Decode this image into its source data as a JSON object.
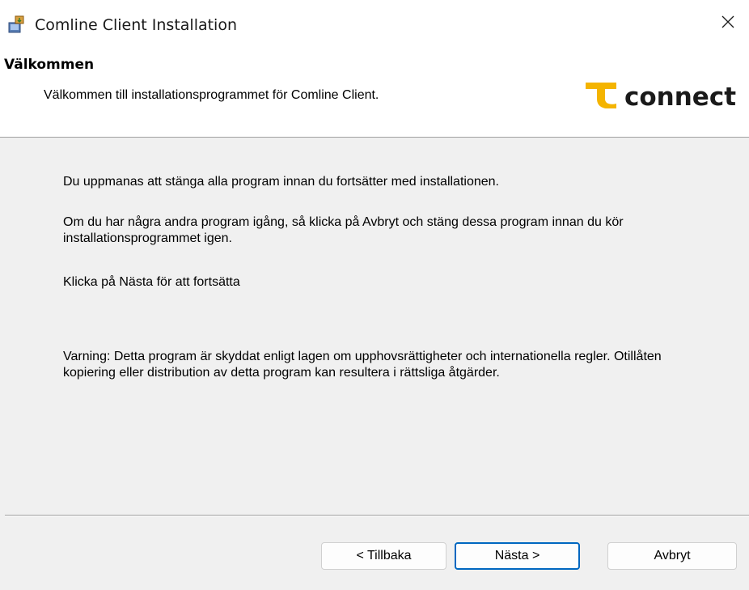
{
  "window": {
    "title": "Comline Client Installation",
    "close_glyph": "✕"
  },
  "header": {
    "title": "Välkommen",
    "subtitle": "Välkommen till installationsprogrammet för Comline Client.",
    "logo_text": "connect"
  },
  "body": {
    "paragraph1": "Du uppmanas att stänga alla program innan du fortsätter med installationen.",
    "paragraph2": "Om du har några andra program igång, så klicka på Avbryt och stäng dessa program innan du kör installationsprogrammet igen.",
    "paragraph3": "Klicka på Nästa för att fortsätta",
    "paragraph4": "Varning: Detta program är skyddat enligt lagen om upphovsrättigheter och internationella regler. Otillåten kopiering eller distribution av detta program kan resultera i rättsliga åtgärder."
  },
  "buttons": {
    "back": "< Tillbaka",
    "next": "Nästa >",
    "cancel": "Avbryt"
  },
  "colors": {
    "logo_accent": "#f4b400",
    "logo_text": "#1a1a1a",
    "focus_border": "#0067c0"
  }
}
